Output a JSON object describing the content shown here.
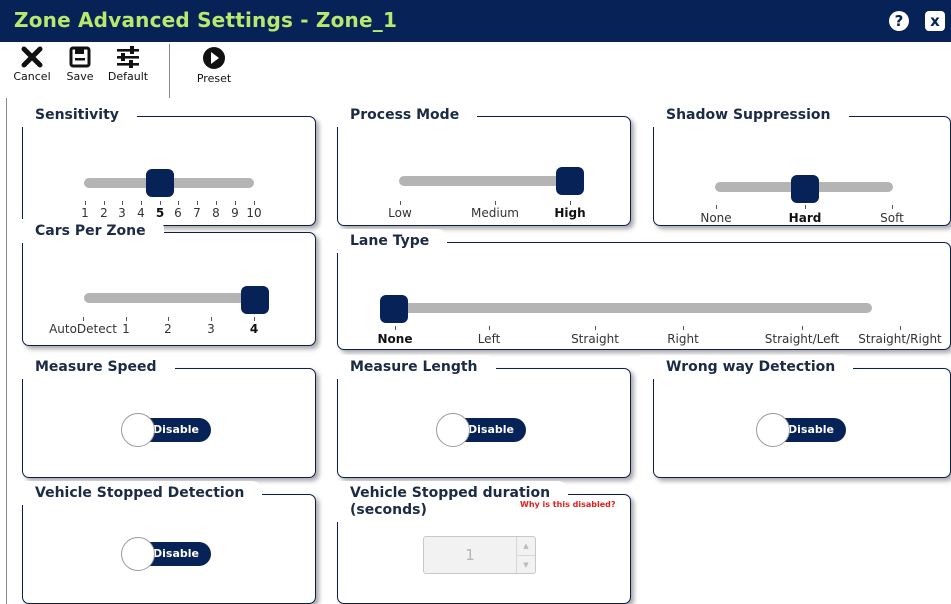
{
  "header": {
    "title": "Zone Advanced Settings - Zone_1",
    "help_glyph": "?",
    "close_glyph": "x"
  },
  "toolbar": {
    "cancel": "Cancel",
    "save": "Save",
    "default": "Default",
    "preset": "Preset"
  },
  "sensitivity": {
    "title": "Sensitivity",
    "labels": [
      "1",
      "2",
      "3",
      "4",
      "5",
      "6",
      "7",
      "8",
      "9",
      "10"
    ],
    "value": "5"
  },
  "process_mode": {
    "title": "Process Mode",
    "labels": [
      "Low",
      "Medium",
      "High"
    ],
    "value": "High"
  },
  "shadow": {
    "title": "Shadow Suppression",
    "labels": [
      "None",
      "Hard",
      "Soft"
    ],
    "value": "Hard"
  },
  "cars": {
    "title": "Cars Per Zone",
    "labels": [
      "AutoDetect",
      "1",
      "2",
      "3",
      "4"
    ],
    "value": "4"
  },
  "lane": {
    "title": "Lane Type",
    "labels": [
      "None",
      "Left",
      "Straight",
      "Right",
      "Straight/Left",
      "Straight/Right"
    ],
    "value": "None"
  },
  "measure_speed": {
    "title": "Measure Speed",
    "toggle": "Disable"
  },
  "measure_length": {
    "title": "Measure Length",
    "toggle": "Disable"
  },
  "wrong_way": {
    "title": "Wrong way Detection",
    "toggle": "Disable"
  },
  "vehicle_stopped": {
    "title": "Vehicle Stopped Detection",
    "toggle": "Disable"
  },
  "stopped_duration": {
    "title_line1": "Vehicle Stopped duration",
    "title_line2": "(seconds)",
    "why": "Why is this disabled?",
    "value": "1"
  },
  "colors": {
    "header_bg": "#072257",
    "title_color": "#b9e86e",
    "accent": "#072257",
    "track": "#b4b4b4",
    "warning": "#e02020"
  }
}
